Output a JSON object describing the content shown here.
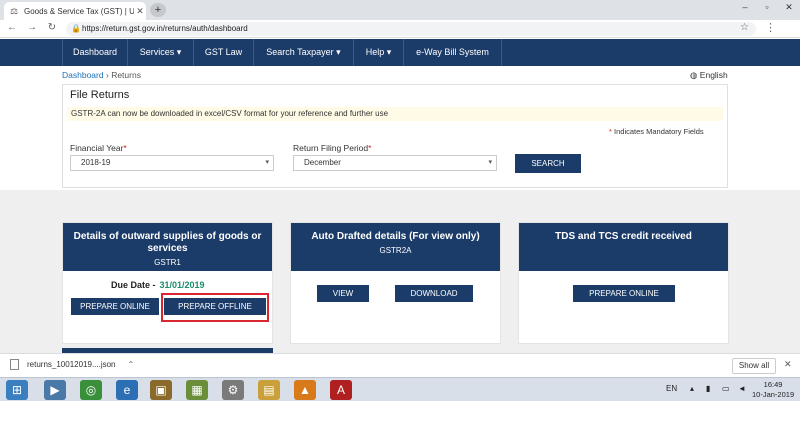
{
  "browser": {
    "tab_title": "Goods & Service Tax (GST) | User",
    "url": "https://return.gst.gov.in/returns/auth/dashboard"
  },
  "nav": {
    "items": [
      "Dashboard",
      "Services ▾",
      "GST Law",
      "Search Taxpayer ▾",
      "Help ▾",
      "e-Way Bill System"
    ]
  },
  "breadcrumb": {
    "home": "Dashboard",
    "sep": "›",
    "current": "Returns"
  },
  "language": "English",
  "file_returns": {
    "title": "File Returns",
    "notice": "GSTR-2A can now be downloaded in excel/CSV format for your reference and further use",
    "mandatory_note": "Indicates Mandatory Fields",
    "financial_year_label": "Financial Year",
    "financial_year_value": "2018-19",
    "period_label": "Return Filing Period",
    "period_value": "December",
    "search_label": "SEARCH",
    "required_mark": "*"
  },
  "tiles": {
    "gstr1": {
      "title": "Details of outward supplies of goods or services",
      "code": "GSTR1",
      "due_label": "Due Date -",
      "due_value": "31/01/2019",
      "btn_online": "PREPARE ONLINE",
      "btn_offline": "PREPARE OFFLINE"
    },
    "gstr2a": {
      "title": "Auto Drafted details (For view only)",
      "code": "GSTR2A",
      "btn_view": "VIEW",
      "btn_download": "DOWNLOAD"
    },
    "tds": {
      "title": "TDS and TCS credit received",
      "btn_online": "PREPARE ONLINE"
    }
  },
  "download_bar": {
    "file_name": "returns_10012019....json",
    "show_all": "Show all"
  },
  "taskbar": {
    "lang": "EN",
    "time": "16:49",
    "date": "10-Jan-2019"
  },
  "colors": {
    "navy": "#1b3b68",
    "due_green": "#1a8c6e",
    "highlight_red": "#d9262f"
  }
}
